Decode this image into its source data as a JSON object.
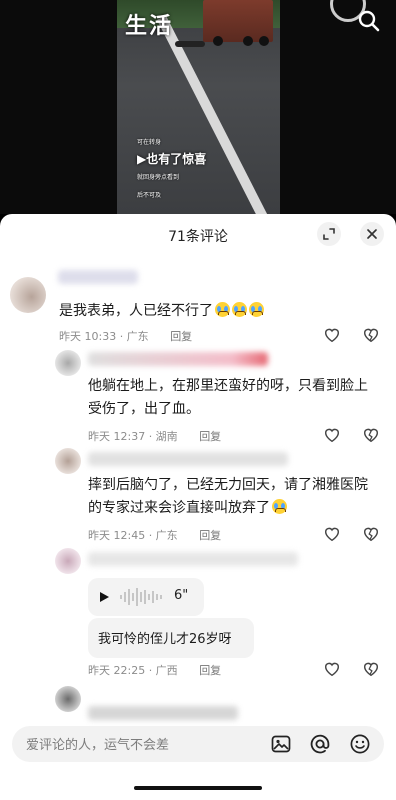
{
  "video": {
    "logo_text": "生活",
    "overlay_line1": "可在转身",
    "overlay_main": "▶也有了惊喜",
    "overlay_line2": "就回身旁点看到",
    "overlay_line3": "后不可及"
  },
  "sheet": {
    "title": "71条评论"
  },
  "comments": [
    {
      "text": "是我表弟，人已经不行了",
      "emoji": [
        "loudly-crying-emoji",
        "loudly-crying-emoji",
        "loudly-crying-emoji"
      ],
      "time": "昨天 10:33 · 广东",
      "reply": "回复"
    },
    {
      "text_line1": "他躺在地上，在那里还蛮好的呀，只看到脸上",
      "text_line2": "受伤了，出了血。",
      "time": "昨天 12:37 · 湖南",
      "reply": "回复"
    },
    {
      "text_line1": "摔到后脑勺了，已经无力回天，请了湘雅医院",
      "text_line2": "的专家过来会诊直接叫放弃了",
      "emoji": [
        "loudly-crying-emoji"
      ],
      "time": "昨天 12:45 · 广东",
      "reply": "回复"
    },
    {
      "voice_duration": "6\"",
      "text": "我可怜的侄儿才26岁呀",
      "time": "昨天 22:25 · 广西",
      "reply": "回复"
    }
  ],
  "input": {
    "placeholder": "爱评论的人，运气不会差"
  },
  "colors": {
    "sheet_bg": "#ffffff",
    "meta_text": "#8c8c8c",
    "input_bg": "#f2f2f2"
  }
}
